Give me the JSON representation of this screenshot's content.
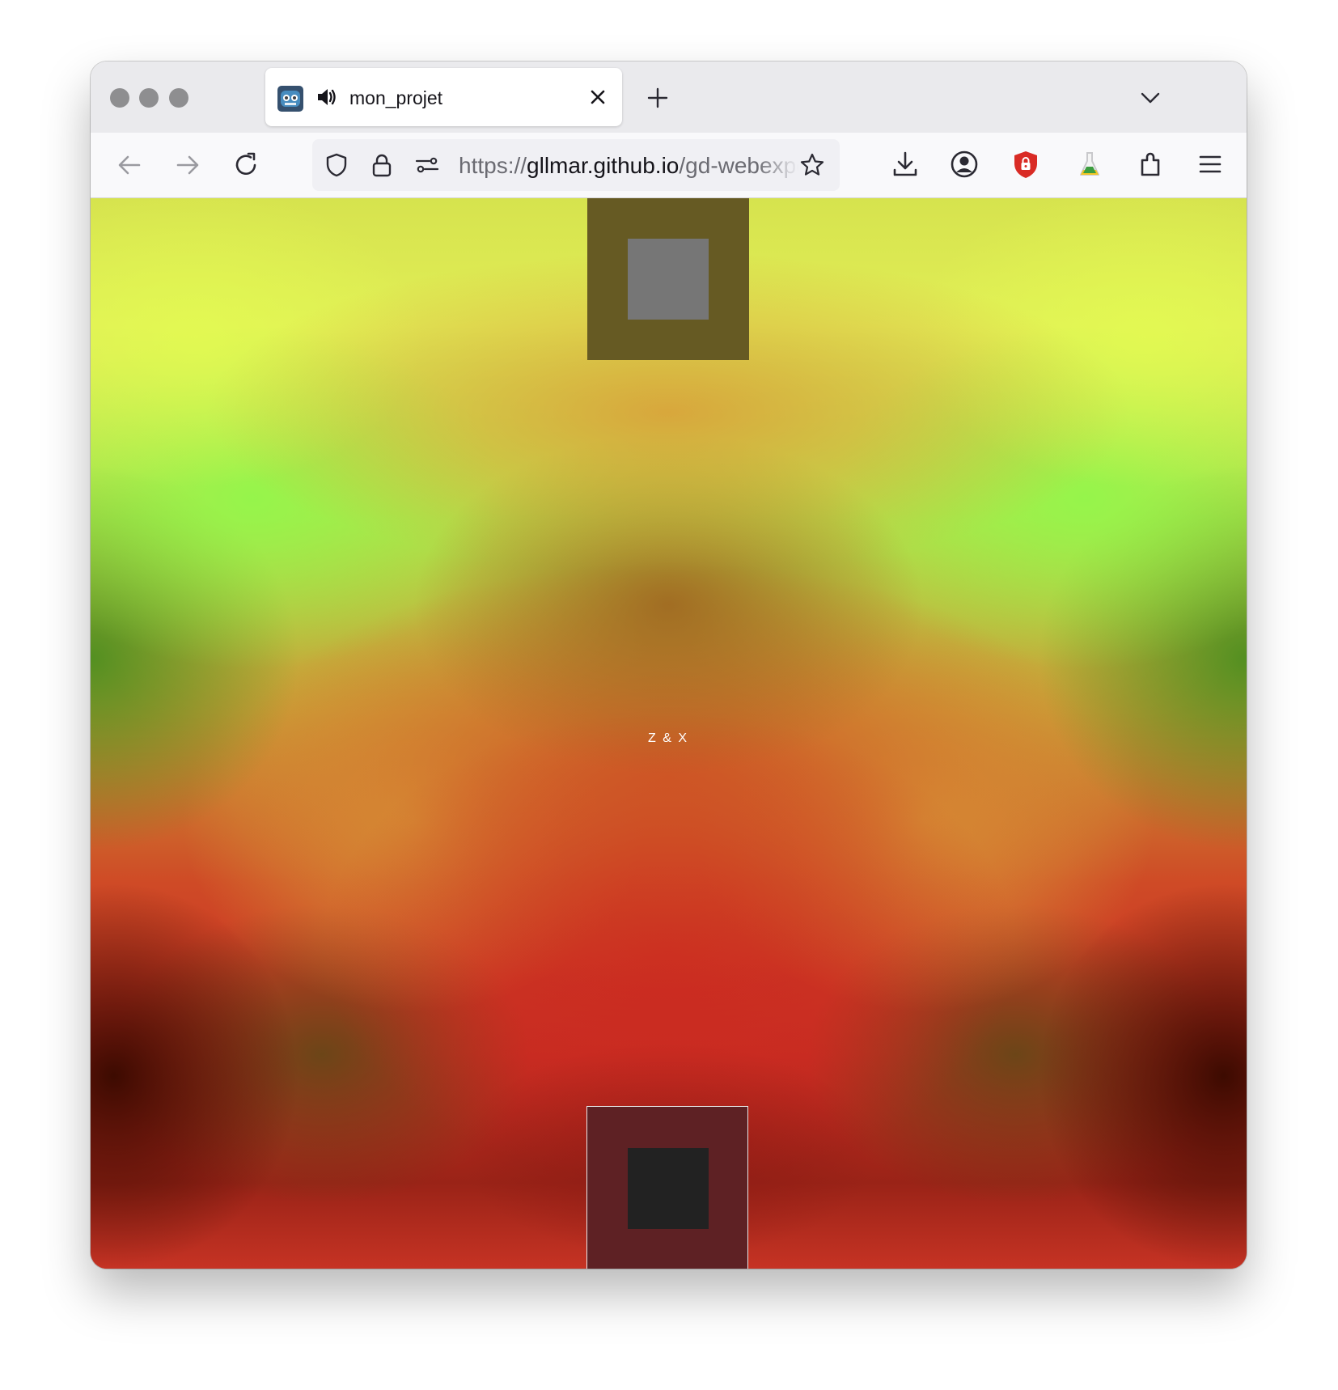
{
  "browser": {
    "tab": {
      "title": "mon_projet",
      "favicon": "godot-icon",
      "audio_icon": "speaker-icon",
      "close_icon": "close-icon"
    },
    "new_tab_icon": "plus-icon",
    "tab_list_icon": "chevron-down-icon",
    "nav": {
      "back_icon": "arrow-left-icon",
      "forward_icon": "arrow-right-icon",
      "reload_icon": "reload-icon"
    },
    "urlbar": {
      "scheme": "https://",
      "host": "gllmar.github.io",
      "path": "/gd-webexport",
      "icons": [
        "shield-icon",
        "lock-icon",
        "permissions-icon",
        "star-icon"
      ]
    },
    "toolbar_icons": [
      "download-icon",
      "account-icon",
      "ublock-shield-icon",
      "flask-icon",
      "extensions-icon",
      "menu-icon"
    ]
  },
  "content": {
    "center_label": "Z & X",
    "colors": {
      "top_square_outer": "#665a23",
      "top_square_inner": "#767676",
      "bottom_square_outer": "#5e2124",
      "bottom_square_inner": "#222222",
      "gradient_yellow": "#e2fa52",
      "gradient_green": "#92f74b",
      "gradient_orange": "#d9a23a",
      "gradient_red": "#c92c22",
      "gradient_dark": "#3a0a00"
    }
  }
}
